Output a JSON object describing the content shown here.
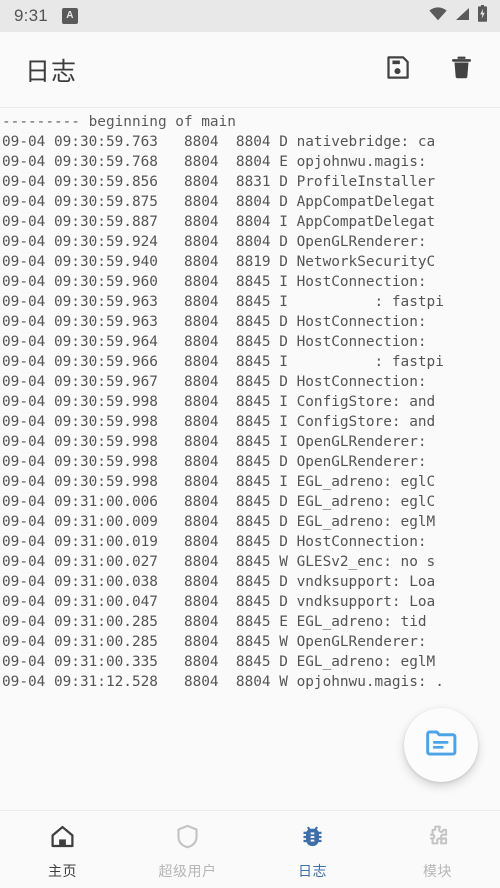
{
  "status_bar": {
    "time": "9:31",
    "notification_icon_glyph": "A",
    "icons": [
      "wifi-icon",
      "cellular-signal-icon",
      "battery-charging-icon"
    ]
  },
  "app_bar": {
    "title": "日志",
    "save_label": "save-icon",
    "delete_label": "delete-icon"
  },
  "log": {
    "lines": [
      "--------- beginning of main",
      "09-04 09:30:59.763   8804  8804 D nativebridge: ca",
      "09-04 09:30:59.768   8804  8804 E opjohnwu.magis:",
      "09-04 09:30:59.856   8804  8831 D ProfileInstaller",
      "09-04 09:30:59.875   8804  8804 D AppCompatDelegat",
      "09-04 09:30:59.887   8804  8804 I AppCompatDelegat",
      "09-04 09:30:59.924   8804  8804 D OpenGLRenderer:",
      "09-04 09:30:59.940   8804  8819 D NetworkSecurityC",
      "09-04 09:30:59.960   8804  8845 I HostConnection:",
      "09-04 09:30:59.963   8804  8845 I          : fastpi",
      "09-04 09:30:59.963   8804  8845 D HostConnection:",
      "09-04 09:30:59.964   8804  8845 D HostConnection:",
      "09-04 09:30:59.966   8804  8845 I          : fastpi",
      "09-04 09:30:59.967   8804  8845 D HostConnection:",
      "09-04 09:30:59.998   8804  8845 I ConfigStore: and",
      "09-04 09:30:59.998   8804  8845 I ConfigStore: and",
      "09-04 09:30:59.998   8804  8845 I OpenGLRenderer:",
      "09-04 09:30:59.998   8804  8845 D OpenGLRenderer:",
      "09-04 09:30:59.998   8804  8845 I EGL_adreno: eglC",
      "09-04 09:31:00.006   8804  8845 D EGL_adreno: eglC",
      "09-04 09:31:00.009   8804  8845 D EGL_adreno: eglM",
      "09-04 09:31:00.019   8804  8845 D HostConnection:",
      "09-04 09:31:00.027   8804  8845 W GLESv2_enc: no s",
      "09-04 09:31:00.038   8804  8845 D vndksupport: Loa",
      "09-04 09:31:00.047   8804  8845 D vndksupport: Loa",
      "09-04 09:31:00.285   8804  8845 E EGL_adreno: tid",
      "09-04 09:31:00.285   8804  8845 W OpenGLRenderer:",
      "09-04 09:31:00.335   8804  8845 D EGL_adreno: eglM",
      "09-04 09:31:12.528   8804  8804 W opjohnwu.magis: ."
    ]
  },
  "fab": {
    "icon": "folder-icon",
    "icon_color": "#4ba3e8"
  },
  "bottom_nav": {
    "items": [
      {
        "label": "主页",
        "icon": "home-icon",
        "active": false
      },
      {
        "label": "超级用户",
        "icon": "shield-icon",
        "active": false
      },
      {
        "label": "日志",
        "icon": "bug-icon",
        "active": true
      },
      {
        "label": "模块",
        "icon": "puzzle-icon",
        "active": false
      }
    ],
    "active_color": "#3f6fa8",
    "inactive_color": "#b6b6b6"
  }
}
